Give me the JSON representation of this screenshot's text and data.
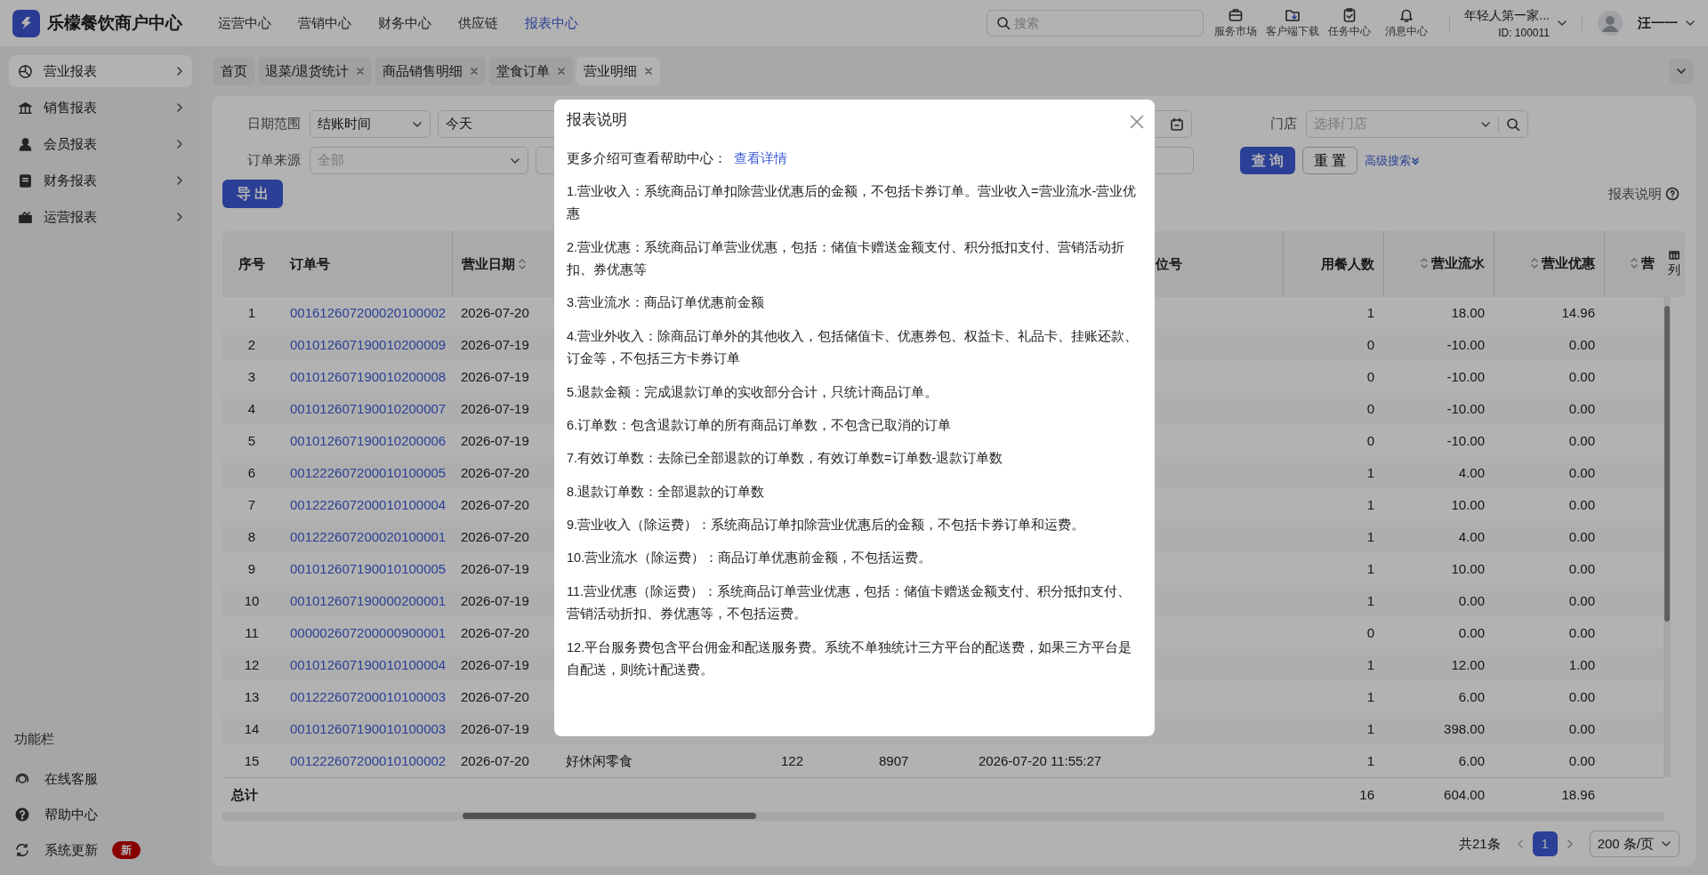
{
  "header": {
    "logo_text": "乐檬餐饮商户中心",
    "nav": [
      {
        "label": "运营中心",
        "selected": false
      },
      {
        "label": "营销中心",
        "selected": false
      },
      {
        "label": "财务中心",
        "selected": false
      },
      {
        "label": "供应链",
        "selected": false
      },
      {
        "label": "报表中心",
        "selected": true
      }
    ],
    "search": {
      "placeholder": "搜索"
    },
    "tools": [
      {
        "label": "服务市场",
        "kind": "briefcase"
      },
      {
        "label": "客户端下载",
        "kind": "folder"
      },
      {
        "label": "任务中心",
        "kind": "clipboard"
      },
      {
        "label": "消息中心",
        "kind": "bell"
      }
    ],
    "account": {
      "name": "年轻人第一家...",
      "id": "ID: 100011"
    },
    "user": {
      "name": "汪一一"
    }
  },
  "sidebar": {
    "items": [
      {
        "label": "营业报表",
        "kind": "pie",
        "selected": true
      },
      {
        "label": "销售报表",
        "kind": "bank",
        "selected": false
      },
      {
        "label": "会员报表",
        "kind": "person",
        "selected": false
      },
      {
        "label": "财务报表",
        "kind": "book",
        "selected": false
      },
      {
        "label": "运营报表",
        "kind": "box",
        "selected": false
      }
    ],
    "section_title": "功能栏",
    "tools": [
      {
        "label": "在线客服",
        "kind": "headset"
      },
      {
        "label": "帮助中心",
        "kind": "help"
      },
      {
        "label": "系统更新",
        "kind": "refresh",
        "badge": "新"
      }
    ]
  },
  "tabs": [
    {
      "label": "首页",
      "selected": false,
      "closable": false
    },
    {
      "label": "退菜/退货统计",
      "selected": false,
      "closable": true
    },
    {
      "label": "商品销售明细",
      "selected": false,
      "closable": true
    },
    {
      "label": "堂食订单",
      "selected": false,
      "closable": true
    },
    {
      "label": "营业明细",
      "selected": true,
      "closable": true
    }
  ],
  "filters": {
    "date_label": "日期范围",
    "date_type": "结账时间",
    "date_preset": "今天",
    "store_label": "门店",
    "store_placeholder": "选择门店",
    "source_label": "订单来源",
    "source_placeholder": "全部",
    "query_button": "查 询",
    "reset_button": "重 置",
    "advanced_link": "高级搜索"
  },
  "export_button": "导 出",
  "help_link": "报表说明",
  "table": {
    "columns": [
      {
        "label": "序号",
        "sortable": false
      },
      {
        "label": "订单号",
        "sortable": false
      },
      {
        "label": "营业日期",
        "sortable": true
      },
      {
        "label": "位号",
        "sortable": false
      },
      {
        "label": "用餐人数",
        "sortable": false
      },
      {
        "label": "营业流水",
        "sortable": true
      },
      {
        "label": "营业优惠",
        "sortable": true
      },
      {
        "label": "营",
        "sortable": true
      }
    ],
    "settings_label": "列",
    "rows": [
      {
        "seq": "1",
        "order_no": "001612607200020100002",
        "date": "2026-07-20",
        "diners": "1",
        "flow": "18.00",
        "discount": "14.96"
      },
      {
        "seq": "2",
        "order_no": "001012607190010200009",
        "date": "2026-07-19",
        "diners": "0",
        "flow": "-10.00",
        "discount": "0.00"
      },
      {
        "seq": "3",
        "order_no": "001012607190010200008",
        "date": "2026-07-19",
        "diners": "0",
        "flow": "-10.00",
        "discount": "0.00"
      },
      {
        "seq": "4",
        "order_no": "001012607190010200007",
        "date": "2026-07-19",
        "diners": "0",
        "flow": "-10.00",
        "discount": "0.00"
      },
      {
        "seq": "5",
        "order_no": "001012607190010200006",
        "date": "2026-07-19",
        "diners": "0",
        "flow": "-10.00",
        "discount": "0.00"
      },
      {
        "seq": "6",
        "order_no": "001222607200010100005",
        "date": "2026-07-20",
        "diners": "1",
        "flow": "4.00",
        "discount": "0.00"
      },
      {
        "seq": "7",
        "order_no": "001222607200010100004",
        "date": "2026-07-20",
        "diners": "1",
        "flow": "10.00",
        "discount": "0.00"
      },
      {
        "seq": "8",
        "order_no": "001222607200020100001",
        "date": "2026-07-20",
        "diners": "1",
        "flow": "4.00",
        "discount": "0.00"
      },
      {
        "seq": "9",
        "order_no": "001012607190010100005",
        "date": "2026-07-19",
        "diners": "1",
        "flow": "10.00",
        "discount": "0.00"
      },
      {
        "seq": "10",
        "order_no": "001012607190000200001",
        "date": "2026-07-19",
        "diners": "1",
        "flow": "0.00",
        "discount": "0.00"
      },
      {
        "seq": "11",
        "order_no": "000002607200000900001",
        "date": "2026-07-20",
        "diners": "0",
        "flow": "0.00",
        "discount": "0.00"
      },
      {
        "seq": "12",
        "order_no": "001012607190010100004",
        "date": "2026-07-19",
        "diners": "1",
        "flow": "12.00",
        "discount": "1.00"
      },
      {
        "seq": "13",
        "order_no": "001222607200010100003",
        "date": "2026-07-20",
        "diners": "1",
        "flow": "6.00",
        "discount": "0.00"
      },
      {
        "seq": "14",
        "order_no": "001012607190010100003",
        "date": "2026-07-19",
        "diners": "1",
        "flow": "398.00",
        "discount": "0.00"
      },
      {
        "seq": "15",
        "order_no": "001222607200010100002",
        "date": "2026-07-20",
        "column_4": "好休闲零食",
        "column_5": "122",
        "column_6": "8907",
        "column_7": "2026-07-20 11:55:27",
        "diners": "1",
        "flow": "6.00",
        "discount": "0.00"
      }
    ],
    "summary": {
      "seq": "总计",
      "diners": "16",
      "flow": "604.00",
      "discount": "18.96"
    }
  },
  "pagination": {
    "total": "共21条",
    "pages": [
      {
        "label": "1",
        "selected": true
      }
    ],
    "page_size": "200 条/页"
  },
  "dialog": {
    "title": "报表说明",
    "intro": "更多介绍可查看帮助中心：",
    "link": "查看详情",
    "items": [
      "1.营业收入：系统商品订单扣除营业优惠后的金额，不包括卡券订单。营业收入=营业流水-营业优惠",
      "2.营业优惠：系统商品订单营业优惠，包括：储值卡赠送金额支付、积分抵扣支付、营销活动折扣、券优惠等",
      "3.营业流水：商品订单优惠前金额",
      "4.营业外收入：除商品订单外的其他收入，包括储值卡、优惠券包、权益卡、礼品卡、挂账还款、订金等，不包括三方卡券订单",
      "5.退款金额：完成退款订单的实收部分合计，只统计商品订单。",
      "6.订单数：包含退款订单的所有商品订单数，不包含已取消的订单",
      "7.有效订单数：去除已全部退款的订单数，有效订单数=订单数-退款订单数",
      "8.退款订单数：全部退款的订单数",
      "9.营业收入（除运费）：系统商品订单扣除营业优惠后的金额，不包括卡券订单和运费。",
      "10.营业流水（除运费）：商品订单优惠前金额，不包括运费。",
      "11.营业优惠（除运费）：系统商品订单营业优惠，包括：储值卡赠送金额支付、积分抵扣支付、营销活动折扣、券优惠等，不包括运费。",
      "12.平台服务费包含平台佣金和配送服务费。系统不单独统计三方平台的配送费，如果三方平台是自配送，则统计配送费。"
    ]
  }
}
